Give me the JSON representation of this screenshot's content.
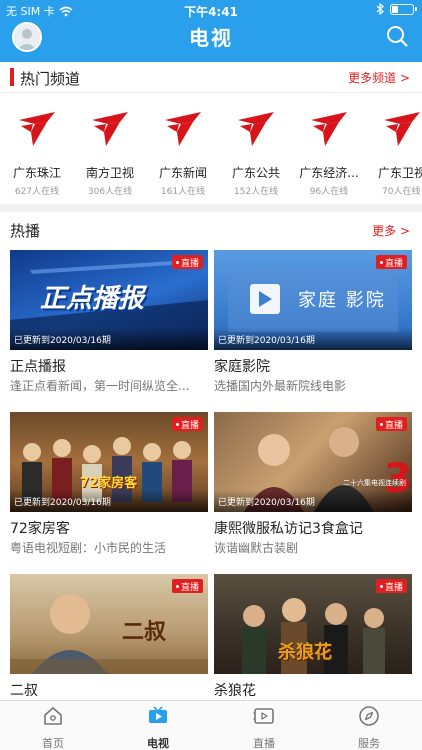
{
  "status_bar": {
    "carrier": "无 SIM 卡",
    "time": "下午4:41"
  },
  "header": {
    "title": "电视"
  },
  "hot_channels": {
    "title": "热门频道",
    "more": "更多频道 >",
    "items": [
      {
        "name": "广东珠江",
        "viewers": "627人在线"
      },
      {
        "name": "南方卫视",
        "viewers": "306人在线"
      },
      {
        "name": "广东新闻",
        "viewers": "161人在线"
      },
      {
        "name": "广东公共",
        "viewers": "152人在线"
      },
      {
        "name": "广东经济...",
        "viewers": "96人在线"
      },
      {
        "name": "广东卫视",
        "viewers": "70人在线"
      }
    ]
  },
  "hot_play": {
    "title": "热播",
    "more": "更多 >",
    "badge": "直播",
    "items": [
      {
        "title": "正点播报",
        "desc": "逢正点看新闻，第一时间纵览全...",
        "updated": "已更新到2020/03/16期",
        "thumb_text": "正点播报"
      },
      {
        "title": "家庭影院",
        "desc": "选播国内外最新院线电影",
        "updated": "已更新到2020/03/16期",
        "thumb_text": "家庭 影院"
      },
      {
        "title": "72家房客",
        "desc": "粤语电视短剧：小市民的生活",
        "updated": "已更新到2020/03/16期",
        "thumb_text": "72家房客"
      },
      {
        "title": "康熙微服私访记3食盒记",
        "desc": "诙谐幽默古装剧",
        "updated": "已更新到2020/03/16期",
        "thumb_text": "二十六集电视连续剧"
      },
      {
        "title": "二叔",
        "desc": "",
        "updated": "",
        "thumb_text": "二叔"
      },
      {
        "title": "杀狼花",
        "desc": "",
        "updated": "",
        "thumb_text": "杀狼花"
      }
    ]
  },
  "tabbar": {
    "items": [
      {
        "label": "首页"
      },
      {
        "label": "电视"
      },
      {
        "label": "直播"
      },
      {
        "label": "服务"
      }
    ]
  },
  "colors": {
    "brand": "#2aa0ec",
    "accent": "#e02020"
  },
  "icons": [
    "wifi-icon",
    "bluetooth-icon",
    "battery-icon",
    "avatar-icon",
    "search-icon",
    "channel-logo-icon",
    "home-icon",
    "tv-icon",
    "live-icon",
    "compass-icon"
  ]
}
